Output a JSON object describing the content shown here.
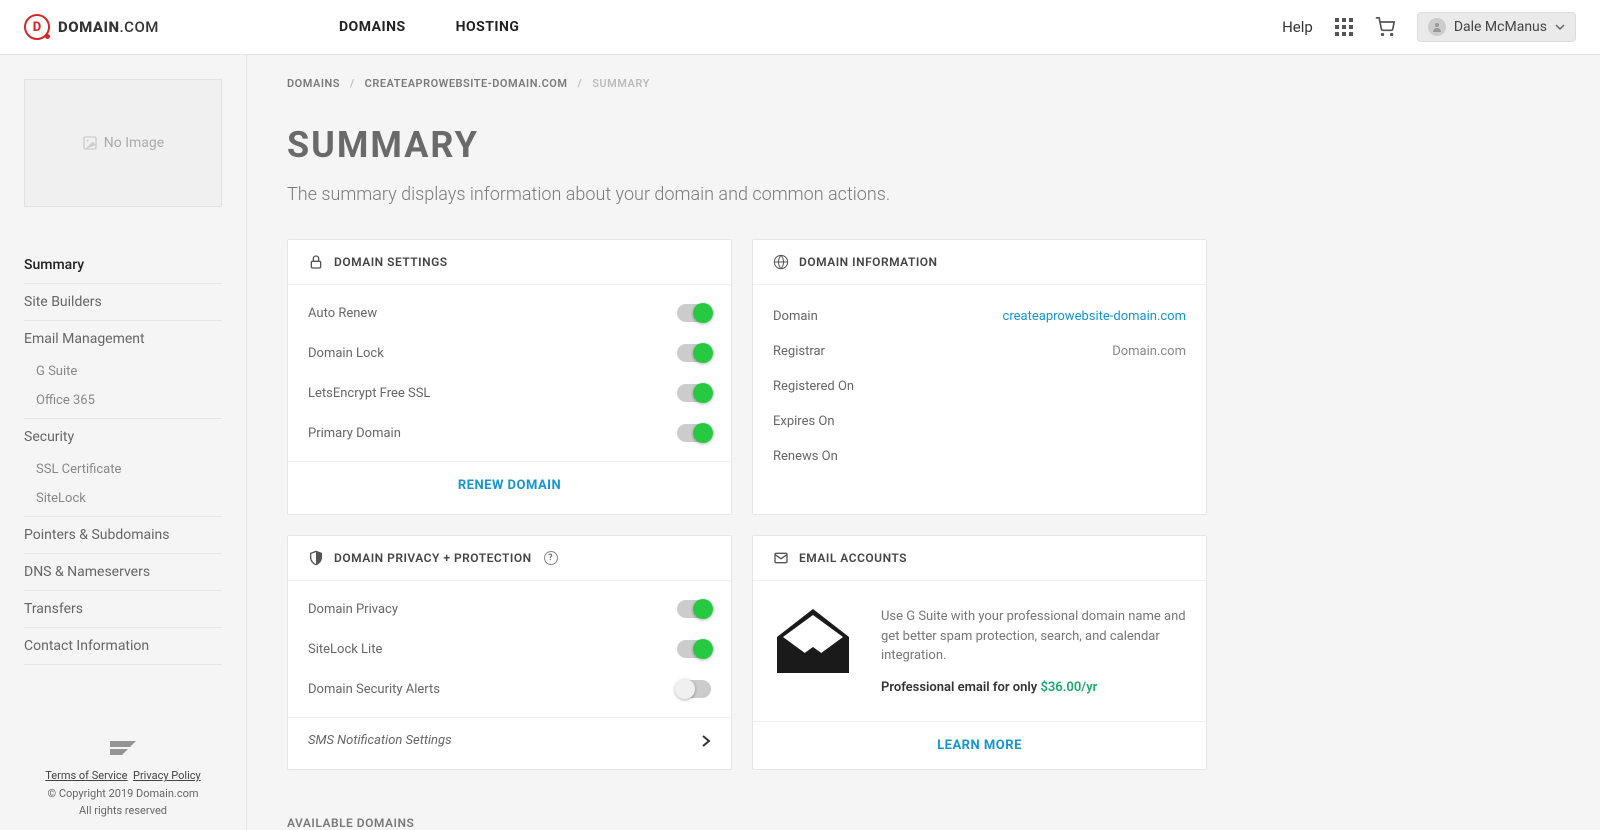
{
  "topnav": {
    "brand_main": "DOMAIN",
    "brand_suffix": ".COM",
    "menu": {
      "domains": "DOMAINS",
      "hosting": "HOSTING"
    },
    "help": "Help",
    "user_name": "Dale McManus"
  },
  "sidebar": {
    "no_image": "No Image",
    "items": {
      "summary": "Summary",
      "site_builders": "Site Builders",
      "email_mgmt": "Email Management",
      "gsuite": "G Suite",
      "office365": "Office 365",
      "security": "Security",
      "ssl_cert": "SSL Certificate",
      "sitelock": "SiteLock",
      "pointers": "Pointers & Subdomains",
      "dns": "DNS & Nameservers",
      "transfers": "Transfers",
      "contact": "Contact Information"
    },
    "footer": {
      "tos": "Terms of Service",
      "privacy": "Privacy Policy",
      "copyright": "© Copyright 2019 Domain.com",
      "rights": "All rights reserved"
    }
  },
  "breadcrumb": {
    "domains": "DOMAINS",
    "domain_name": "CREATEAPROWEBSITE-DOMAIN.COM",
    "current": "SUMMARY"
  },
  "page": {
    "title": "SUMMARY",
    "subtitle": "The summary displays information about your domain and common actions."
  },
  "domain_settings": {
    "header": "DOMAIN SETTINGS",
    "auto_renew": "Auto Renew",
    "domain_lock": "Domain Lock",
    "lets_encrypt": "LetsEncrypt Free SSL",
    "primary_domain": "Primary Domain",
    "renew_action": "RENEW DOMAIN"
  },
  "domain_info": {
    "header": "DOMAIN INFORMATION",
    "domain_lbl": "Domain",
    "domain_val": "createaprowebsite-domain.com",
    "registrar_lbl": "Registrar",
    "registrar_val": "Domain.com",
    "registered_lbl": "Registered On",
    "expires_lbl": "Expires On",
    "renews_lbl": "Renews On"
  },
  "privacy": {
    "header": "DOMAIN PRIVACY + PROTECTION",
    "domain_privacy": "Domain Privacy",
    "sitelock_lite": "SiteLock Lite",
    "security_alerts": "Domain Security Alerts",
    "sms": "SMS Notification Settings"
  },
  "email_accounts": {
    "header": "EMAIL ACCOUNTS",
    "body": "Use G Suite with your professional domain name and get better spam protection, search, and calendar integration.",
    "price_prefix": "Professional email for only ",
    "price": "$36.00/yr",
    "learn_more": "LEARN MORE"
  },
  "available_domains": "AVAILABLE DOMAINS"
}
